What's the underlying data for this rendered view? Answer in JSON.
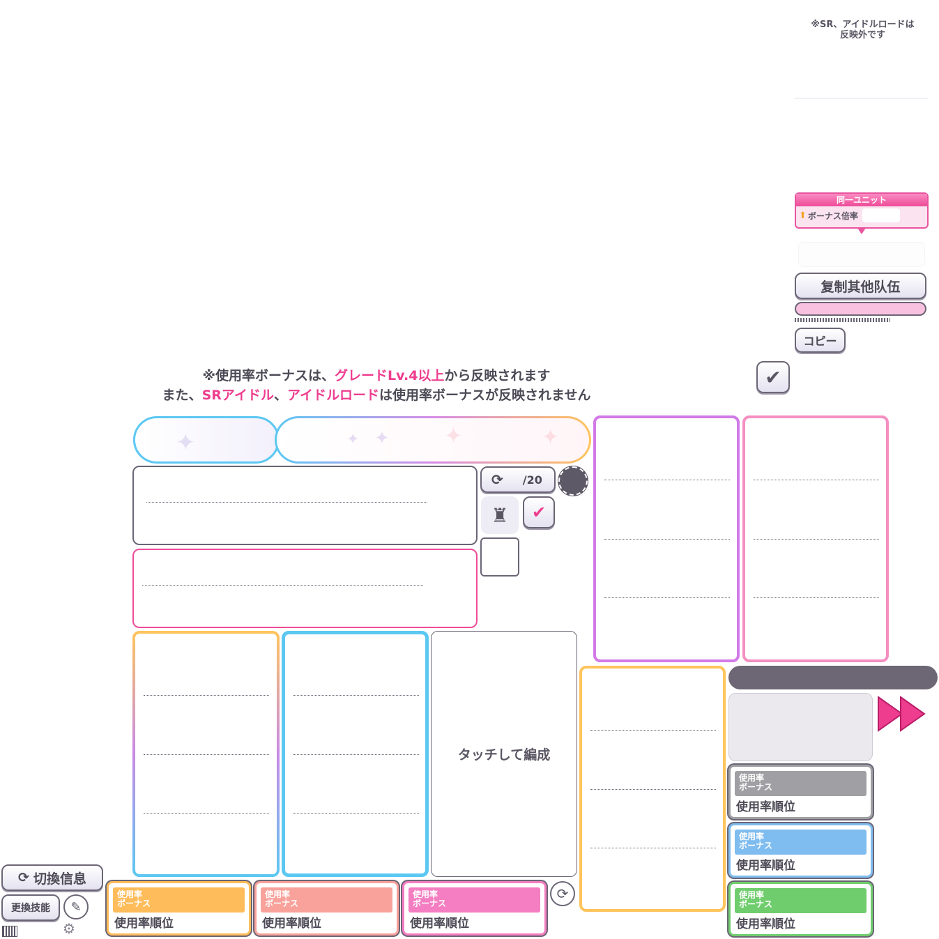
{
  "top_note": {
    "line1": "※SR、アイドルロードは",
    "line2": "反映外です"
  },
  "unit_bonus": {
    "title": "同一ユニット",
    "label": "ボーナス倍率",
    "value": ""
  },
  "buttons": {
    "copy_other_team": "复制其他队伍",
    "copy": "コピー",
    "switch_info": "切換信息",
    "change_skill": "更換技能"
  },
  "notice": {
    "line1_a": "※使用率ボーナスは、",
    "line1_b": "グレードLv.4以上",
    "line1_c": "から反映されます",
    "line2_a": "また、",
    "line2_b": "SRアイドル",
    "line2_c": "、",
    "line2_d": "アイドルロード",
    "line2_e": "は使用率ボーナスが反映されません"
  },
  "counter": {
    "value": "/20"
  },
  "empty_slot": {
    "label": "タッチして編成"
  },
  "rank_cards": [
    {
      "head": "使用率\nボーナス",
      "label": "使用率順位",
      "color": "#ffbc5a"
    },
    {
      "head": "使用率\nボーナス",
      "label": "使用率順位",
      "color": "#f8a29b"
    },
    {
      "head": "使用率\nボーナス",
      "label": "使用率順位",
      "color": "#f47ec1"
    },
    {
      "head": "使用率\nボーナス",
      "label": "使用率順位",
      "color": "#a0a0a4"
    },
    {
      "head": "使用率\nボーナス",
      "label": "使用率順位",
      "color": "#7fbcef"
    },
    {
      "head": "使用率\nボーナス",
      "label": "使用率順位",
      "color": "#70cd6e"
    }
  ],
  "colors": {
    "pink": "#ee3d8f",
    "border": "#6b6575",
    "purple": "#d27ae8",
    "orange": "#ffc45c",
    "blue": "#5cc8f2"
  }
}
